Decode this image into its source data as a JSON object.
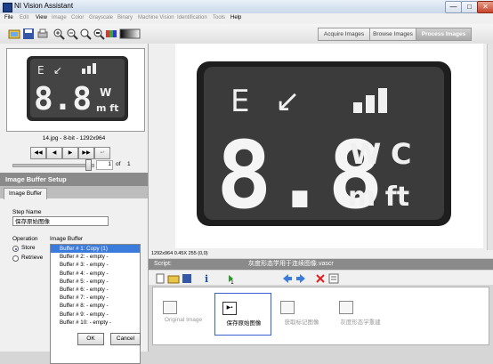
{
  "window": {
    "title": "NI Vision Assistant",
    "minimize": "—",
    "maximize": "□",
    "close": "✕"
  },
  "menu": [
    {
      "label": "File",
      "enabled": true
    },
    {
      "label": "Edit",
      "enabled": false
    },
    {
      "label": "View",
      "enabled": true
    },
    {
      "label": "Image",
      "enabled": false
    },
    {
      "label": "Color",
      "enabled": false
    },
    {
      "label": "Grayscale",
      "enabled": false
    },
    {
      "label": "Binary",
      "enabled": false
    },
    {
      "label": "Machine Vision",
      "enabled": false
    },
    {
      "label": "Identification",
      "enabled": false
    },
    {
      "label": "Tools",
      "enabled": false
    },
    {
      "label": "Help",
      "enabled": true
    }
  ],
  "toolbar": {
    "tabs": [
      "Acquire Images",
      "Browse Images",
      "Process Images"
    ],
    "active_tab": "Process Images"
  },
  "image_browser": {
    "info": "14.jpg - 8-bit - 1292x964",
    "page": "1",
    "of_label": "of",
    "total": "1",
    "nav_icons": [
      "first-icon",
      "prev-icon",
      "next-icon",
      "last-icon",
      "return-icon"
    ]
  },
  "image_content": {
    "symbol_arrow": "↙",
    "digits": "8.8",
    "unit_top": "W",
    "unit_top2": "C",
    "unit_bottom": "m ft"
  },
  "setup": {
    "header": "Image Buffer Setup",
    "tab": "Image Buffer",
    "step_name_label": "Step Name",
    "step_name_value": "保存原始图像",
    "operation_label": "Operation",
    "operations": [
      {
        "label": "Store",
        "checked": true
      },
      {
        "label": "Retrieve",
        "checked": false
      }
    ],
    "buffer_label": "Image Buffer",
    "buffers": [
      "Buffer # 1:  Copy (1)",
      "Buffer # 2:  - empty -",
      "Buffer # 3:  - empty -",
      "Buffer # 4:  - empty -",
      "Buffer # 5:  - empty -",
      "Buffer # 6:  - empty -",
      "Buffer # 7:  - empty -",
      "Buffer # 8:  - empty -",
      "Buffer # 9:  - empty -",
      "Buffer # 10:  - empty -"
    ],
    "selected_buffer": 0,
    "ok": "OK",
    "cancel": "Cancel"
  },
  "status": "1292x964 0.45X 255   (0,0)",
  "script": {
    "label": "Script:",
    "filename": "灰度形态学用于连续图像.vascr",
    "steps": [
      {
        "label": "Original Image",
        "active": false
      },
      {
        "label": "保存原始图像",
        "active": true
      },
      {
        "label": "获取标记图像",
        "active": false
      },
      {
        "label": "灰度形态学重建",
        "active": false
      }
    ]
  },
  "colors": {
    "accent": "#3a7bdc",
    "header_gray": "#8a8a8a",
    "active_tab": "#a9a9a9"
  }
}
